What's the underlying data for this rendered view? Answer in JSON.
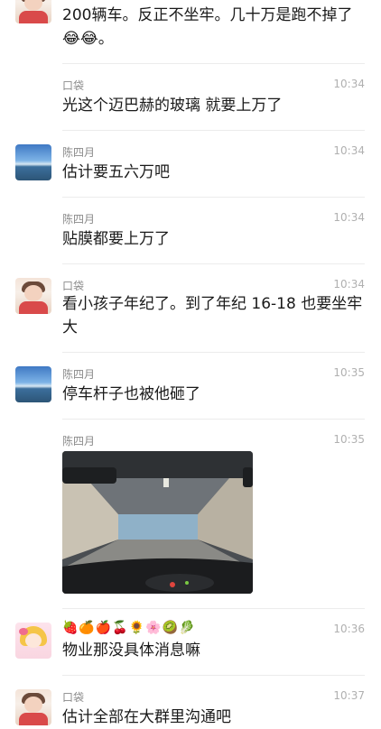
{
  "messages": [
    {
      "sender": "",
      "time": "",
      "text": "200辆车。反正不坐牢。几十万是跑不掉了",
      "emoji_suffix": "😂😂。"
    },
    {
      "sender": "口袋",
      "time": "10:34",
      "text": "光这个迈巴赫的玻璃 就要上万了"
    },
    {
      "sender": "陈四月",
      "time": "10:34",
      "text": "估计要五六万吧"
    },
    {
      "sender": "陈四月",
      "time": "10:34",
      "text": "贴膜都要上万了"
    },
    {
      "sender": "口袋",
      "time": "10:34",
      "text": "看小孩子年纪了。到了年纪 16-18 也要坐牢大"
    },
    {
      "sender": "陈四月",
      "time": "10:35",
      "text": "停车杆子也被他砸了"
    },
    {
      "sender": "陈四月",
      "time": "10:35",
      "text": ""
    },
    {
      "sender": "",
      "time": "10:36",
      "emoji_line": "🍓🍊🍎🍒🌻🌸🥝🥬",
      "text": "物业那没具体消息嘛"
    },
    {
      "sender": "口袋",
      "time": "10:37",
      "text": "估计全部在大群里沟通吧"
    }
  ],
  "icons": {
    "avatar_kid": "child-photo-avatar",
    "avatar_sea": "seaside-landscape-avatar",
    "avatar_anime": "anime-girl-avatar",
    "photo": "tunnel-drive-photo"
  }
}
